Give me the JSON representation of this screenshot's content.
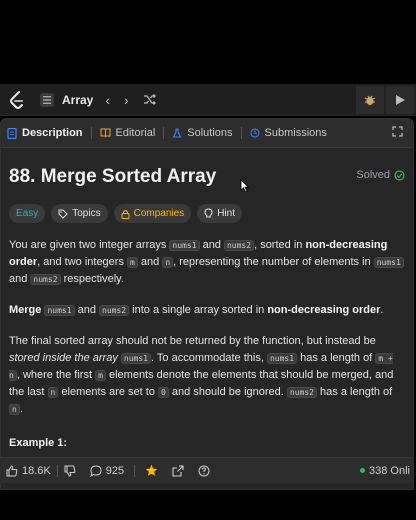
{
  "topbar": {
    "title": "Array",
    "prev_icon": "chevron-left-icon",
    "next_icon": "chevron-right-icon",
    "shuffle_icon": "shuffle-icon"
  },
  "tabs": {
    "description": "Description",
    "editorial": "Editorial",
    "solutions": "Solutions",
    "submissions": "Submissions"
  },
  "problem": {
    "title": "88. Merge Sorted Array",
    "status": "Solved"
  },
  "tags": {
    "difficulty": "Easy",
    "topics": "Topics",
    "companies": "Companies",
    "hint": "Hint"
  },
  "desc": {
    "p1_a": "You are given two integer arrays ",
    "p1_nums1": "nums1",
    "p1_b": " and ",
    "p1_nums2": "nums2",
    "p1_c": ", sorted in ",
    "p1_bold": "non-decreasing order",
    "p1_d": ", and two integers ",
    "p1_m": "m",
    "p1_e": " and ",
    "p1_n": "n",
    "p1_f": ", representing the number of elements in ",
    "p1_nums1b": "nums1",
    "p1_g": " and ",
    "p1_nums2b": "nums2",
    "p1_h": " respectively.",
    "p2_bold1": "Merge",
    "p2_nums1": "nums1",
    "p2_a": " and ",
    "p2_nums2": "nums2",
    "p2_b": " into a single array sorted in ",
    "p2_bold2": "non-decreasing order",
    "p2_c": ".",
    "p3_a": "The final sorted array should not be returned by the function, but instead be ",
    "p3_italic": "stored inside the array",
    "p3_nums1": "nums1",
    "p3_b": ". To accommodate this, ",
    "p3_nums1b": "nums1",
    "p3_c": " has a length of ",
    "p3_code": "m + n",
    "p3_d": ", where the first ",
    "p3_m": "m",
    "p3_e": " elements denote the elements that should be merged, and the last ",
    "p3_n": "n",
    "p3_f": " elements are set to ",
    "p3_zero": "0",
    "p3_g": " and should be ignored. ",
    "p3_nums2": "nums2",
    "p3_h": " has a length of ",
    "p3_n2": "n",
    "p3_i": "."
  },
  "example_heading": "Example 1:",
  "bottom": {
    "likes": "18.6K",
    "comments": "925",
    "online": "338 Onli"
  },
  "colors": {
    "easy": "#1cb8b8",
    "companies": "#ffb800",
    "star": "#ffb800",
    "online_dot": "#2cbb5d",
    "description_icon": "#3b82f6",
    "solutions_icon": "#3b82f6",
    "submissions_icon": "#3b82f6",
    "editorial_icon": "#ffa116"
  }
}
